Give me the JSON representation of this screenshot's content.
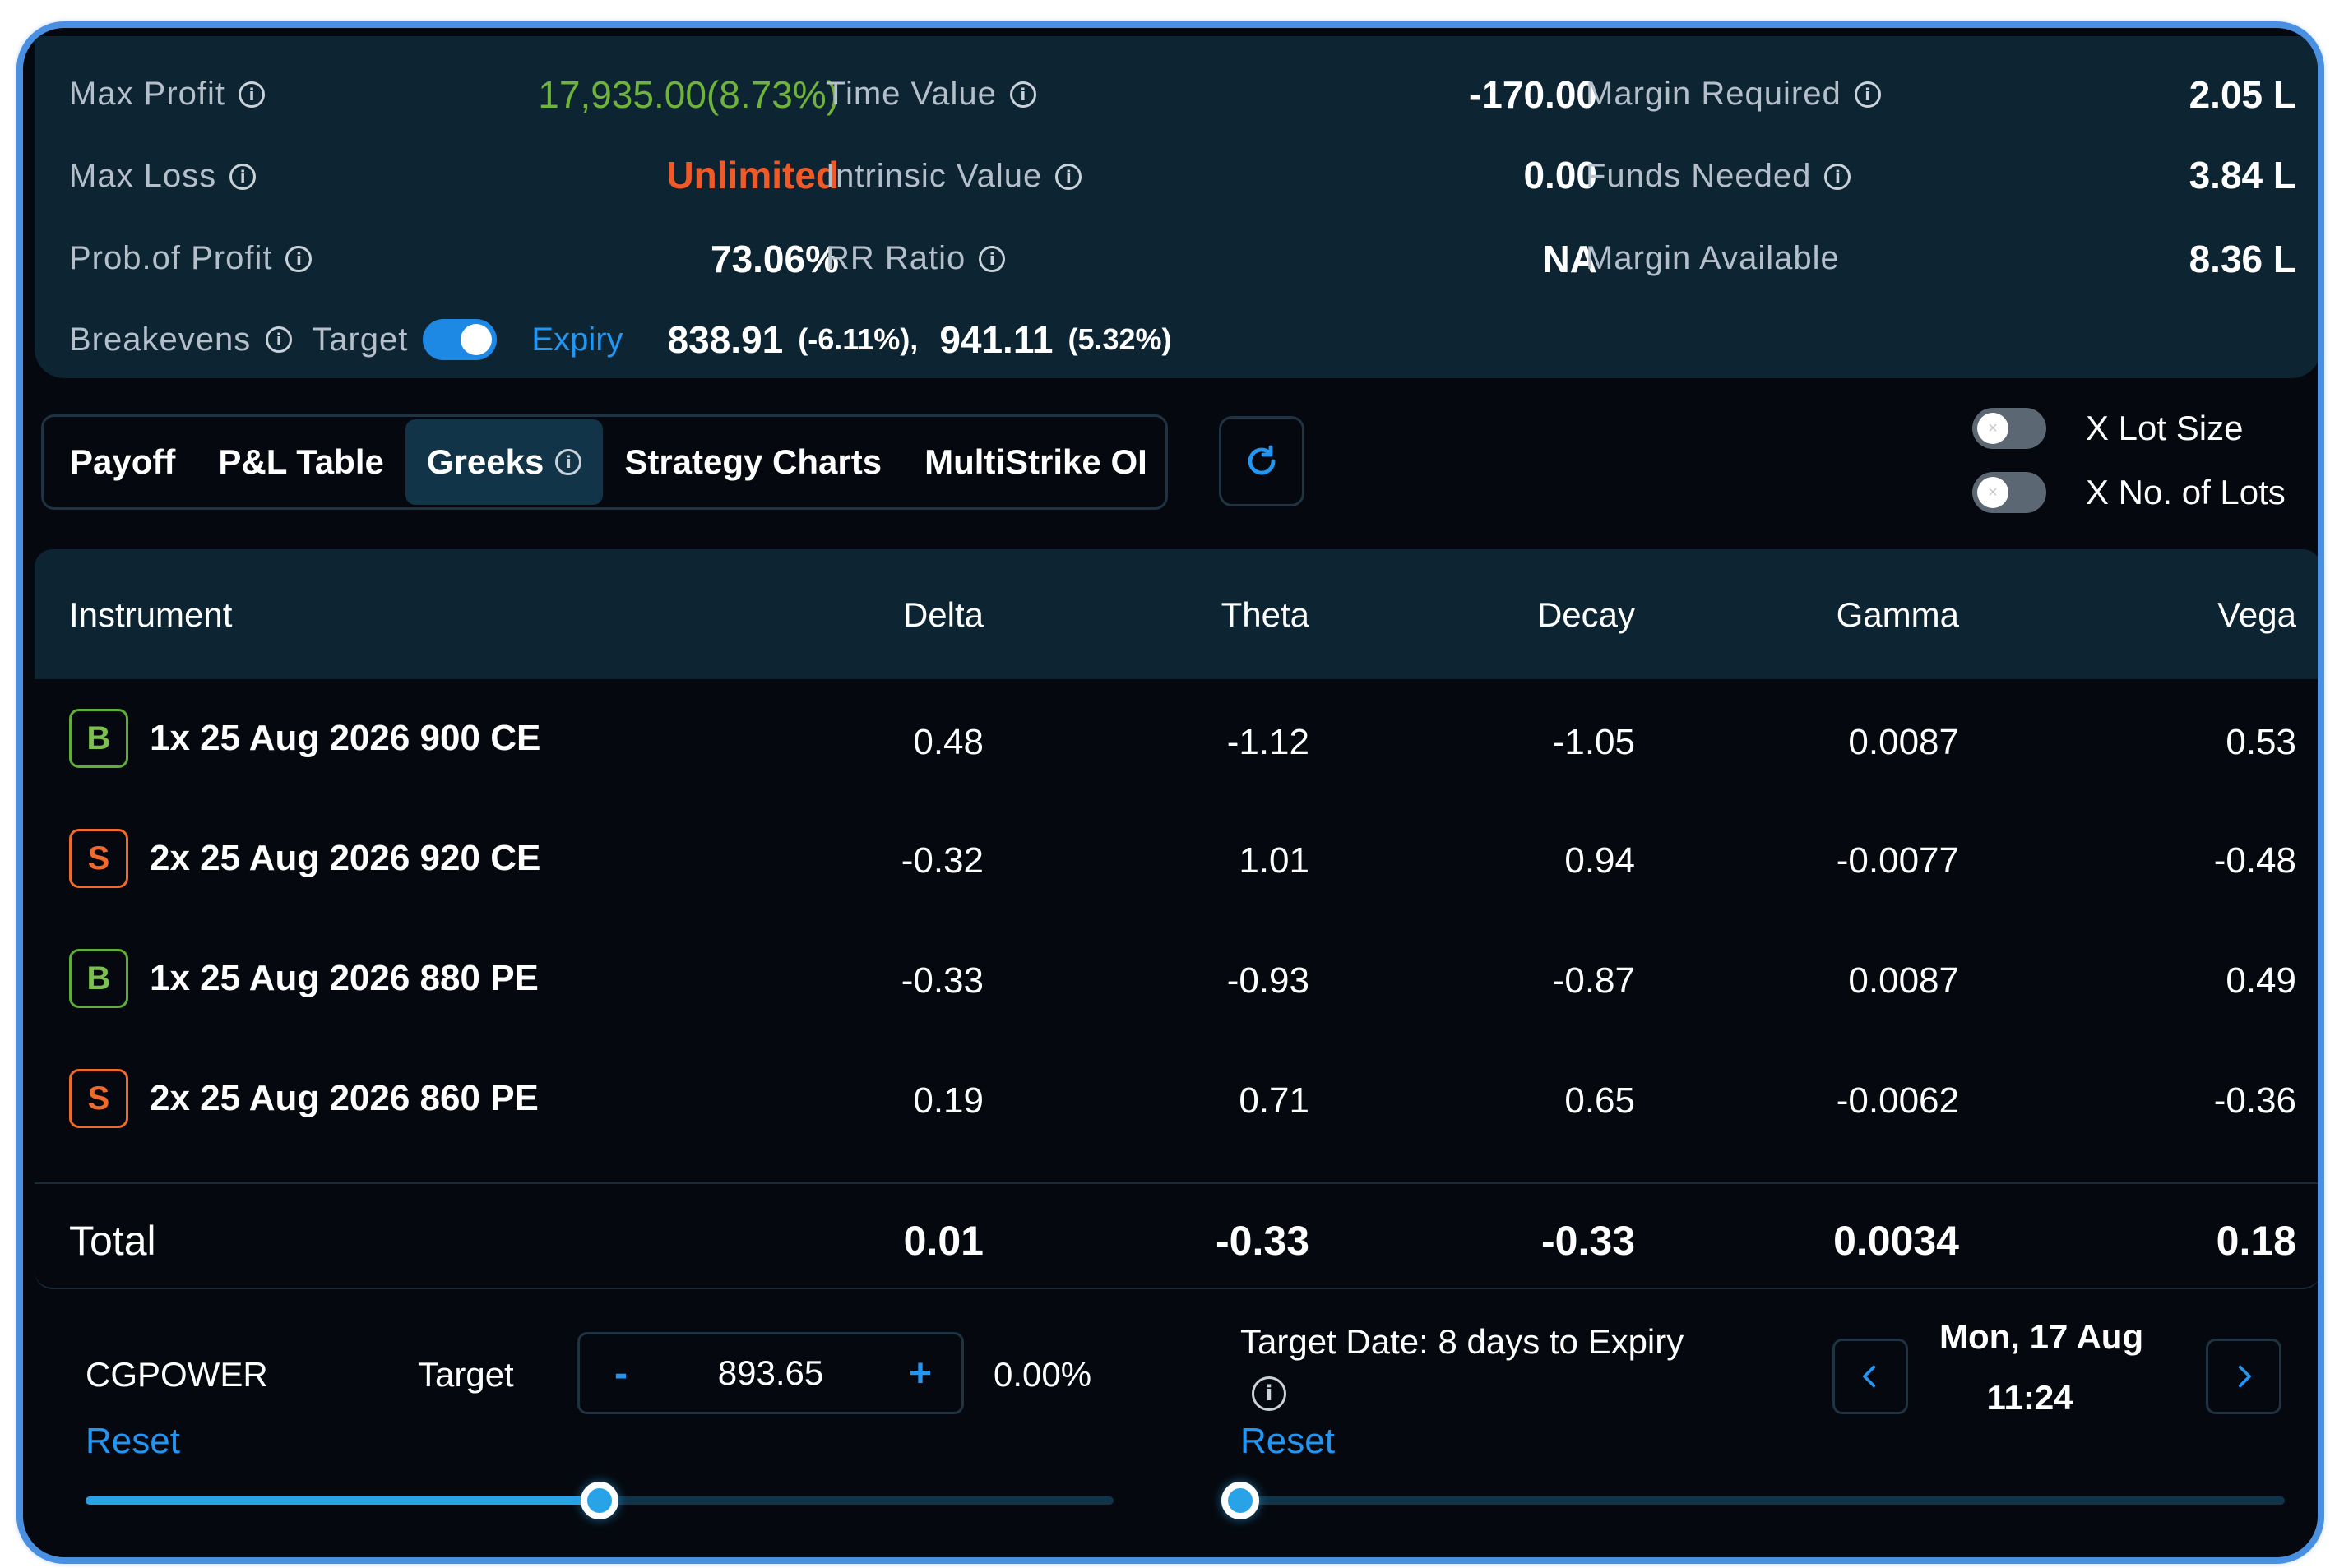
{
  "summary": {
    "max_profit": {
      "label": "Max Profit",
      "value": "17,935.00(8.73%)"
    },
    "max_loss": {
      "label": "Max Loss",
      "value": "Unlimited"
    },
    "prob_profit": {
      "label": "Prob.of Profit",
      "value": "73.06%"
    },
    "time_value": {
      "label": "Time Value",
      "value": "-170.00"
    },
    "intrinsic_value": {
      "label": "Intrinsic Value",
      "value": "0.00"
    },
    "rr_ratio": {
      "label": "RR Ratio",
      "value": "NA"
    },
    "margin_required": {
      "label": "Margin Required",
      "value": "2.05 L"
    },
    "funds_needed": {
      "label": "Funds Needed",
      "value": "3.84 L"
    },
    "margin_available": {
      "label": "Margin Available",
      "value": "8.36 L"
    },
    "breakevens": {
      "label": "Breakevens",
      "target_label": "Target",
      "expiry_label": "Expiry",
      "toggle_on": true,
      "value1": "838.91",
      "pct1": "(-6.11%),",
      "value2": "941.11",
      "pct2": "(5.32%)"
    }
  },
  "tabs": [
    {
      "label": "Payoff",
      "active": false
    },
    {
      "label": "P&L Table",
      "active": false
    },
    {
      "label": "Greeks",
      "active": true
    },
    {
      "label": "Strategy Charts",
      "active": false
    },
    {
      "label": "MultiStrike OI",
      "active": false
    }
  ],
  "toggles": {
    "lot_size": {
      "label": "X Lot Size",
      "on": false
    },
    "no_of_lots": {
      "label": "X No. of Lots",
      "on": false
    }
  },
  "table": {
    "headers": [
      "Instrument",
      "Delta",
      "Theta",
      "Decay",
      "Gamma",
      "Vega"
    ],
    "rows": [
      {
        "side": "B",
        "instrument": "1x 25 Aug 2026 900 CE",
        "delta": "0.48",
        "theta": "-1.12",
        "decay": "-1.05",
        "gamma": "0.0087",
        "vega": "0.53"
      },
      {
        "side": "S",
        "instrument": "2x 25 Aug 2026 920 CE",
        "delta": "-0.32",
        "theta": "1.01",
        "decay": "0.94",
        "gamma": "-0.0077",
        "vega": "-0.48"
      },
      {
        "side": "B",
        "instrument": "1x 25 Aug 2026 880 PE",
        "delta": "-0.33",
        "theta": "-0.93",
        "decay": "-0.87",
        "gamma": "0.0087",
        "vega": "0.49"
      },
      {
        "side": "S",
        "instrument": "2x 25 Aug 2026 860 PE",
        "delta": "0.19",
        "theta": "0.71",
        "decay": "0.65",
        "gamma": "-0.0062",
        "vega": "-0.36"
      }
    ],
    "total": {
      "label": "Total",
      "delta": "0.01",
      "theta": "-0.33",
      "decay": "-0.33",
      "gamma": "0.0034",
      "vega": "0.18"
    }
  },
  "controls": {
    "symbol": "CGPOWER",
    "target_label": "Target",
    "target_value": "893.65",
    "minus": "-",
    "plus": "+",
    "target_pct": "0.00%",
    "reset_label": "Reset",
    "target_date_label": "Target Date: 8 days to Expiry",
    "date_line1": "Mon, 17 Aug",
    "date_line2": "11:24",
    "date_reset_label": "Reset",
    "price_slider_fraction": 0.5,
    "date_slider_fraction": 0.0
  },
  "colors": {
    "accent": "#2196f3",
    "profit": "#6fb33a",
    "loss": "#f05a28",
    "panel": "#0d2533",
    "background": "#05090f"
  }
}
